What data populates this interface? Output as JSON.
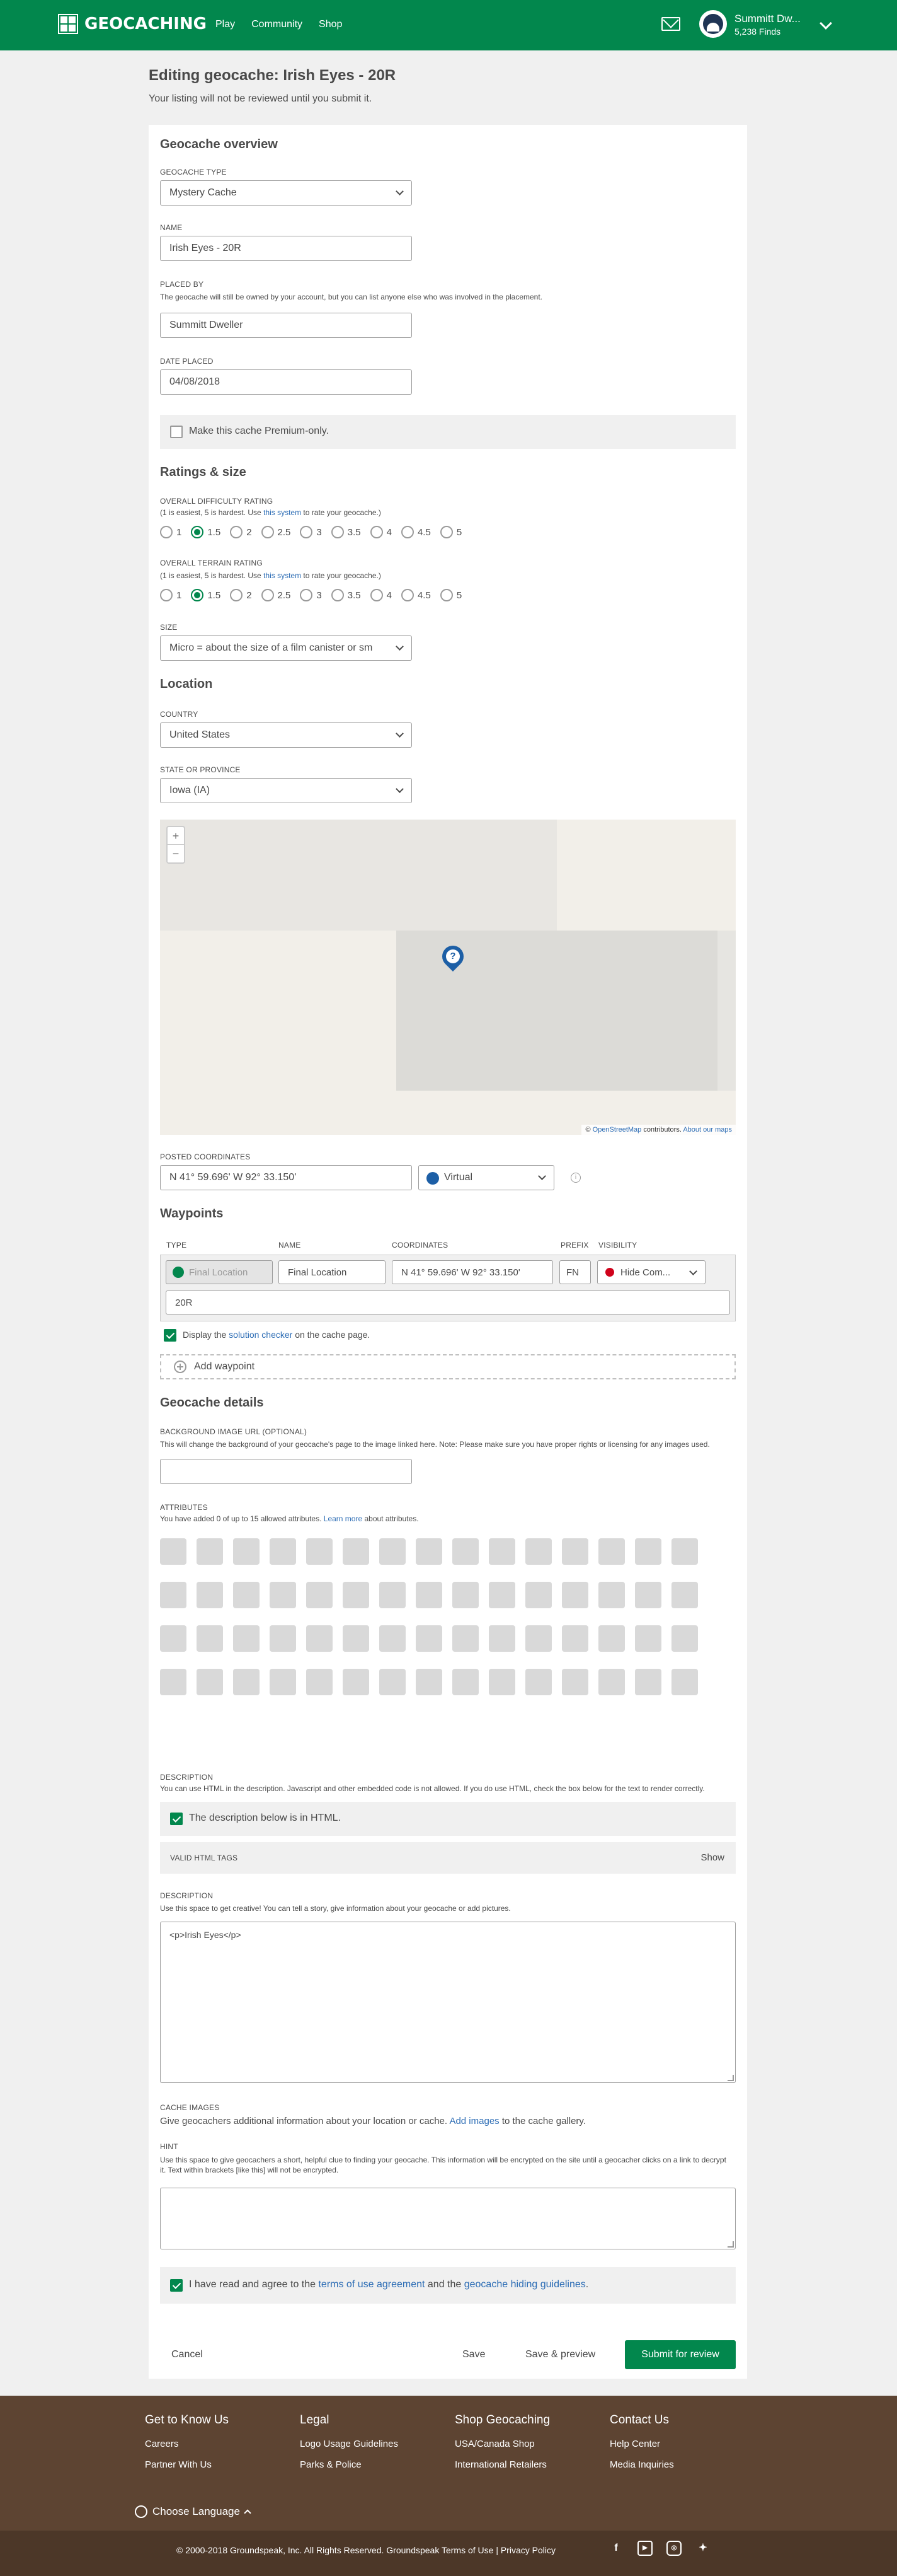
{
  "header": {
    "brand": "GEOCACHING",
    "nav": [
      "Play",
      "Community",
      "Shop"
    ],
    "user_name": "Summitt Dw...",
    "user_finds": "5,238 Finds"
  },
  "page": {
    "title": "Editing geocache: Irish Eyes - 20R",
    "subtitle": "Your listing will not be reviewed until you submit it."
  },
  "overview": {
    "heading": "Geocache overview",
    "type_label": "GEOCACHE TYPE",
    "type_value": "Mystery Cache",
    "name_label": "NAME",
    "name_value": "Irish Eyes - 20R",
    "placed_by_label": "PLACED BY",
    "placed_by_help": "The geocache will still be owned by your account, but you can list anyone else who was involved in the placement.",
    "placed_by_value": "Summitt Dweller",
    "date_label": "DATE PLACED",
    "date_value": "04/08/2018",
    "premium_label": "Make this cache Premium-only."
  },
  "ratings": {
    "heading": "Ratings & size",
    "difficulty_label": "OVERALL DIFFICULTY RATING",
    "difficulty_help_pre": "(1 is easiest, 5 is hardest. Use ",
    "difficulty_help_link": "this system",
    "difficulty_help_post": " to rate your geocache.)",
    "difficulty_options": [
      "1",
      "1.5",
      "2",
      "2.5",
      "3",
      "3.5",
      "4",
      "4.5",
      "5"
    ],
    "difficulty_selected": "1.5",
    "terrain_label": "OVERALL TERRAIN RATING",
    "terrain_help_pre": "(1 is easiest, 5 is hardest. Use ",
    "terrain_help_link": "this system",
    "terrain_help_post": " to rate your geocache.)",
    "terrain_options": [
      "1",
      "1.5",
      "2",
      "2.5",
      "3",
      "3.5",
      "4",
      "4.5",
      "5"
    ],
    "terrain_selected": "1.5",
    "size_label": "SIZE",
    "size_value": "Micro = about the size of a film canister or sm"
  },
  "location": {
    "heading": "Location",
    "country_label": "COUNTRY",
    "country_value": "United States",
    "state_label": "STATE OR PROVINCE",
    "state_value": "Iowa (IA)",
    "map_zoom_in": "+",
    "map_zoom_out": "−",
    "map_pin_glyph": "?",
    "map_attribution_prefix": "© ",
    "map_attribution_link1": "OpenStreetMap",
    "map_attribution_mid": " contributors. ",
    "map_attribution_link2": "About our maps",
    "coords_label": "POSTED COORDINATES",
    "coords_value": "N 41° 59.696' W 92° 33.150'",
    "coords_type": "Virtual"
  },
  "waypoints": {
    "heading": "Waypoints",
    "col_type": "TYPE",
    "col_name": "NAME",
    "col_coords": "COORDINATES",
    "col_prefix": "PREFIX",
    "col_visibility": "VISIBILITY",
    "row_type": "Final Location",
    "row_name": "Final Location",
    "row_coords": "N 41° 59.696' W 92° 33.150'",
    "row_prefix": "FN",
    "row_visibility": "Hide Com...",
    "row_note": "20R",
    "checker_pre": "Display the ",
    "checker_link": "solution checker",
    "checker_post": " on the cache page.",
    "add_label": "Add waypoint"
  },
  "details": {
    "heading": "Geocache details",
    "bg_label": "BACKGROUND IMAGE URL (OPTIONAL)",
    "bg_help": "This will change the background of your geocache's page to the image linked here. Note: Please make sure you have proper rights or licensing for any images used.",
    "attr_label": "ATTRIBUTES",
    "attr_help_pre": "You have added 0 of up to 15 allowed attributes. ",
    "attr_help_link": "Learn more",
    "attr_help_post": " about attributes.",
    "attributes": [
      "dog",
      "dollar",
      "phone",
      "ticket",
      "pill",
      "clock",
      "binoculars",
      "hike",
      "climb",
      "swim",
      "wheel",
      "night",
      "snow",
      "horse",
      "campfire",
      "snowmobile",
      "bolt",
      "mountain",
      "poison",
      "tick",
      "wheelchair",
      "parking",
      "bus",
      "water",
      "restroom",
      "phone2",
      "picnic",
      "tent",
      "bike",
      "motorcycle",
      "quad",
      "truck",
      "boat",
      "scuba",
      "flashlight",
      "uv",
      "snowshoe",
      "ski",
      "tool",
      "cow",
      "nature",
      "stealth",
      "sun",
      "thorn",
      "field",
      "kid",
      "boat2",
      "tree",
      "danger",
      "car",
      "water2",
      "fuel",
      "food",
      "stroller",
      "flashlight2",
      "star",
      "stamp",
      "park",
      "bench",
      "tree2"
    ],
    "desc_label": "DESCRIPTION",
    "desc_help": "You can use HTML in the description. Javascript and other embedded code is not allowed. If you do use HTML, check the box below for the text to render correctly.",
    "html_check_label": "The description below is in HTML.",
    "valid_tags_label": "VALID HTML TAGS",
    "valid_tags_toggle": "Show",
    "desc2_label": "DESCRIPTION",
    "desc2_help": "Use this space to get creative! You can tell a story, give information about your geocache or add pictures.",
    "desc2_value": "<p>Irish Eyes</p>",
    "images_label": "CACHE IMAGES",
    "images_help_pre": "Give geocachers additional information about your location or cache. ",
    "images_help_link": "Add images",
    "images_help_post": " to the cache gallery.",
    "hint_label": "HINT",
    "hint_help": "Use this space to give geocachers a short, helpful clue to finding your geocache. This information will be encrypted on the site until a geocacher clicks on a link to decrypt it. Text within brackets [like this] will not be encrypted.",
    "terms_pre": "I have read and agree to the ",
    "terms_link1": "terms of use agreement",
    "terms_mid": " and the ",
    "terms_link2": "geocache hiding guidelines",
    "terms_post": "."
  },
  "actions": {
    "cancel": "Cancel",
    "save": "Save",
    "save_preview": "Save & preview",
    "submit": "Submit for review"
  },
  "footer": {
    "col1_title": "Get to Know Us",
    "col1_items": [
      "Careers",
      "Partner With Us"
    ],
    "col2_title": "Legal",
    "col2_items": [
      "Logo Usage Guidelines",
      "Parks & Police"
    ],
    "col3_title": "Shop Geocaching",
    "col3_items": [
      "USA/Canada Shop",
      "International Retailers"
    ],
    "col4_title": "Contact Us",
    "col4_items": [
      "Help Center",
      "Media Inquiries"
    ],
    "language": "Choose Language",
    "copyright": "© 2000-2018 Groundspeak, Inc. All Rights Reserved. Groundspeak Terms of Use | Privacy Policy"
  },
  "colors": {
    "brand_green": "#02874d",
    "footer_brown": "#5d4432",
    "link_blue": "#2d6db5"
  }
}
